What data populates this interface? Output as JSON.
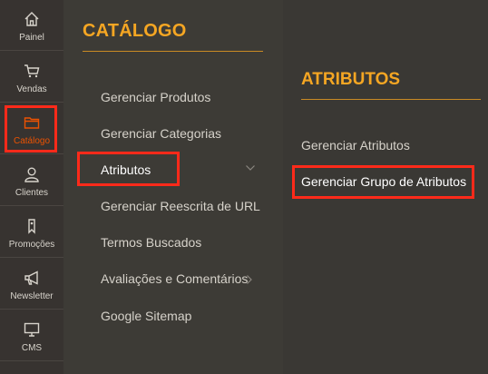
{
  "sidebar": {
    "items": [
      {
        "label": "Painel",
        "icon": "home-icon"
      },
      {
        "label": "Vendas",
        "icon": "cart-icon"
      },
      {
        "label": "Catálogo",
        "icon": "folder-icon"
      },
      {
        "label": "Clientes",
        "icon": "user-icon"
      },
      {
        "label": "Promoções",
        "icon": "tag-icon"
      },
      {
        "label": "Newsletter",
        "icon": "megaphone-icon"
      },
      {
        "label": "CMS",
        "icon": "monitor-icon"
      }
    ],
    "active_color": "#eb5202"
  },
  "catalog": {
    "title": "CATÁLOGO",
    "links": [
      "Gerenciar Produtos",
      "Gerenciar Categorias",
      "Atributos",
      "Gerenciar Reescrita de URL",
      "Termos Buscados",
      "Avaliações e Comentários",
      "Google Sitemap"
    ]
  },
  "attributes": {
    "title": "ATRIBUTOS",
    "links": [
      "Gerenciar Atributos",
      "Gerenciar Grupo de Atributos"
    ]
  },
  "colors": {
    "accent": "#f5a623",
    "highlight": "#ff2a1a"
  }
}
